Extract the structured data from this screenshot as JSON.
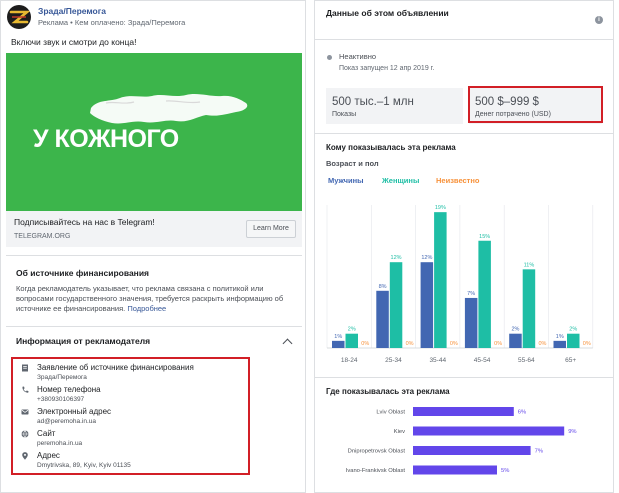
{
  "ad": {
    "page_name": "Зрада/Перемога",
    "sponsor_prefix": "Реклама • Кем оплачено: ",
    "sponsor_name": "Зрада/Перемога",
    "primary_text": "Включи звук и смотри до конца!",
    "creative_text": "У КОЖНОГО",
    "headline": "Подписывайтесь на нас в Telegram!",
    "caption": "TELEGRAM.ORG",
    "cta_label": "Learn More"
  },
  "funding": {
    "title": "Об источнике финансирования",
    "body": "Когда рекламодатель указывает, что реклама связана с политикой или вопросами государственного значения, требуется раскрыть информацию об источнике ее финансирования.",
    "link": "Подробнее"
  },
  "advertiser": {
    "title": "Информация от рекламодателя",
    "items": [
      {
        "icon": "document-icon",
        "label": "Заявление об источнике финансирования",
        "value": "Зрада/Перемога"
      },
      {
        "icon": "phone-icon",
        "label": "Номер телефона",
        "value": "+380930106397"
      },
      {
        "icon": "email-icon",
        "label": "Электронный адрес",
        "value": "ad@peremoha.in.ua"
      },
      {
        "icon": "globe-icon",
        "label": "Сайт",
        "value": "peremoha.in.ua"
      },
      {
        "icon": "pin-icon",
        "label": "Адрес",
        "value": "Dmytrivska, 89, Kyiv, Kyiv 01135"
      }
    ]
  },
  "data_panel": {
    "title": "Данные об этом объявлении",
    "status": "Неактивно",
    "started": "Показ запущен 12 апр 2019 г.",
    "impressions_value": "500 тыс.–1 млн",
    "impressions_label": "Показы",
    "spend_value": "500 $–999 $",
    "spend_label": "Денег потрачено (USD)",
    "shown_title": "Кому показывалась эта реклама",
    "age_title": "Возраст и пол",
    "region_title": "Где показывалась эта реклама"
  },
  "colors": {
    "men": "#4267b2",
    "women": "#1ebea5",
    "unknown": "#f7923b",
    "region": "#6246ea",
    "highlight": "#d21f26"
  },
  "chart_data": [
    {
      "type": "bar",
      "categories": [
        "18-24",
        "25-34",
        "35-44",
        "45-54",
        "55-64",
        "65+"
      ],
      "series": [
        {
          "name": "Мужчины",
          "values": [
            1,
            8,
            12,
            7,
            2,
            1
          ],
          "labels": [
            "1%",
            "8%",
            "12%",
            "7%",
            "2%",
            "1%"
          ]
        },
        {
          "name": "Женщины",
          "values": [
            2,
            12,
            19,
            15,
            11,
            2
          ],
          "labels": [
            "2%",
            "12%",
            "19%",
            "15%",
            "11%",
            "2%"
          ]
        },
        {
          "name": "Неизвестно",
          "values": [
            0,
            0,
            0,
            0,
            0,
            0
          ],
          "labels": [
            "0%",
            "0%",
            "0%",
            "0%",
            "0%",
            "0%"
          ]
        }
      ],
      "ylim": [
        0,
        20
      ],
      "legend": "top-left"
    },
    {
      "type": "bar",
      "orientation": "horizontal",
      "categories": [
        "Lviv Oblast",
        "Kiev",
        "Dnipropetrovsk Oblast",
        "Ivano-Frankivsk Oblast"
      ],
      "values": [
        6,
        9,
        7,
        5
      ],
      "labels": [
        "6%",
        "9%",
        "7%",
        "5%"
      ],
      "xlim": [
        0,
        10
      ]
    }
  ]
}
